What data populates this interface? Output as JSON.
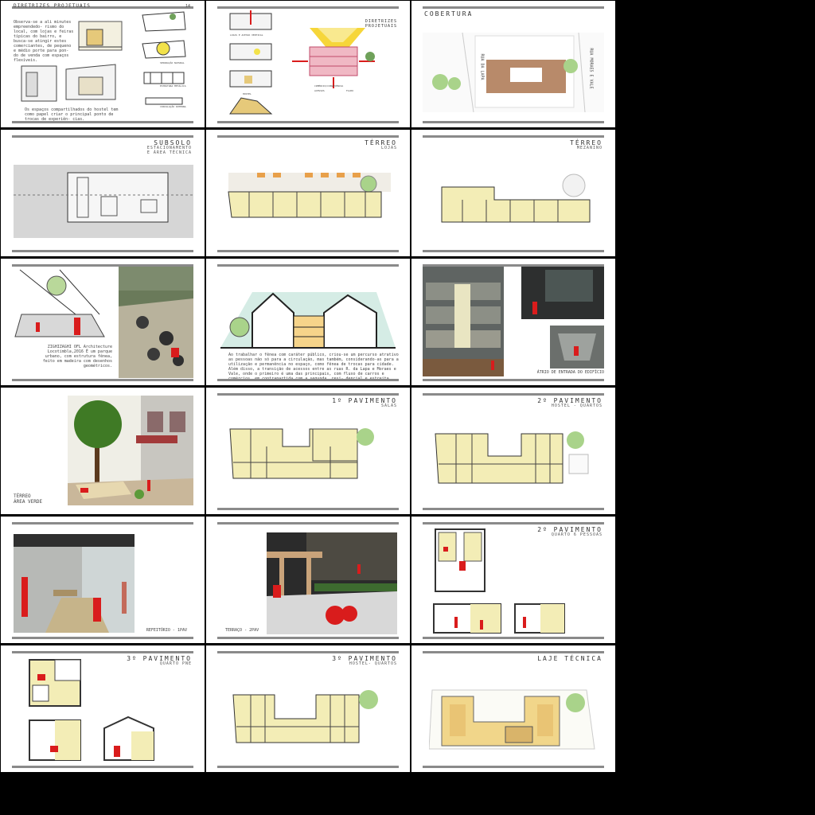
{
  "panels": {
    "p1": {
      "title": "DIRETRIZES PROJETUAIS",
      "page_no": "14",
      "text1": "Observa-se a ali minutes empreendedo- rismo do local, com lojas e feiras típicas do bairro, e busca-se atingir estes comerciantes, de pequeno e médio porte para pon- do de venda com espaços flexíveis.",
      "text2": "Os espaços compartilhados do hostel tem como papel criar o principal ponto de trocas de experiên- cias.",
      "labels": [
        "SEPARAÇÃO NATURAL",
        "ESTRUTURA METÁLICA",
        "CIRCULAÇÃO INTERNA"
      ]
    },
    "p2": {
      "title": "DIRETRIZES PROJETUAIS",
      "labels": [
        "LOJAS E ACESSO VERTICAL",
        "HOSTEL",
        "COMÉRCIO/CONVIVÊNCIA",
        "ACESSOS",
        "FLUXO"
      ]
    },
    "p3": {
      "title": "COBERTURA",
      "street1": "RUA DA LAPA",
      "street2": "RUA MORAES E VALE"
    },
    "p4": {
      "title": "SUBSOLO",
      "sub1": "ESTACIONAMENTO",
      "sub2": "E ÁREA TÉCNICA"
    },
    "p5": {
      "title": "TÉRREO",
      "sub1": "LOJAS"
    },
    "p6": {
      "title": "TÉRREO",
      "sub1": "MEZANINO"
    },
    "p7": {
      "caption": "ZIGHIZAGHI OFL Architecture Locotimbla,2016 É um parque urbano, com estrutura fênea, feito em madeira com desenhos geométricos."
    },
    "p8": {
      "caption": "Ao trabalhar o fênea com caráter público, criou-se um percurso atrativo as pessoas não só para a circulação, mas também, considerando-as para a utilização e permanência no espaço, como fênea de trocas para cidade. Além disso, a transição de acessos entre as ruas R. da Lapa e Moraes e Vale, onde o primeiro é uma das principais, com fluxo de carros e comércios, em contrapartida com a segunda, resi- dencial e estreita."
    },
    "p9": {
      "caption": "ÁTRIO DE ENTRADA DO EDIFÍCIO"
    },
    "p10": {
      "cap1": "TÉRREO",
      "cap2": "ÁREA VERDE"
    },
    "p11": {
      "title": "1º PAVIMENTO",
      "sub1": "SALAS"
    },
    "p12": {
      "title": "2º PAVIMENTO",
      "sub1": "HOSTEL - QUARTOS"
    },
    "p13": {
      "caption": "REFEITÓRIO - 1PAV"
    },
    "p14": {
      "caption": "TERRAÇO - 2PAV"
    },
    "p15": {
      "title": "2º PAVIMENTO",
      "sub1": "QUARTO 6 PESSOAS"
    },
    "p16": {
      "title": "3º PAVIMENTO",
      "sub1": "QUARTO PNE"
    },
    "p17": {
      "title": "3º PAVIMENTO",
      "sub1": "HOSTEL- QUARTOS"
    },
    "p18": {
      "title": "LAJE TÉCNICA"
    }
  },
  "colors": {
    "plan_fill": "#f3edb6",
    "accent_red": "#d91c1c",
    "tree": "#a9d38a",
    "roof": "#b88a6a"
  }
}
